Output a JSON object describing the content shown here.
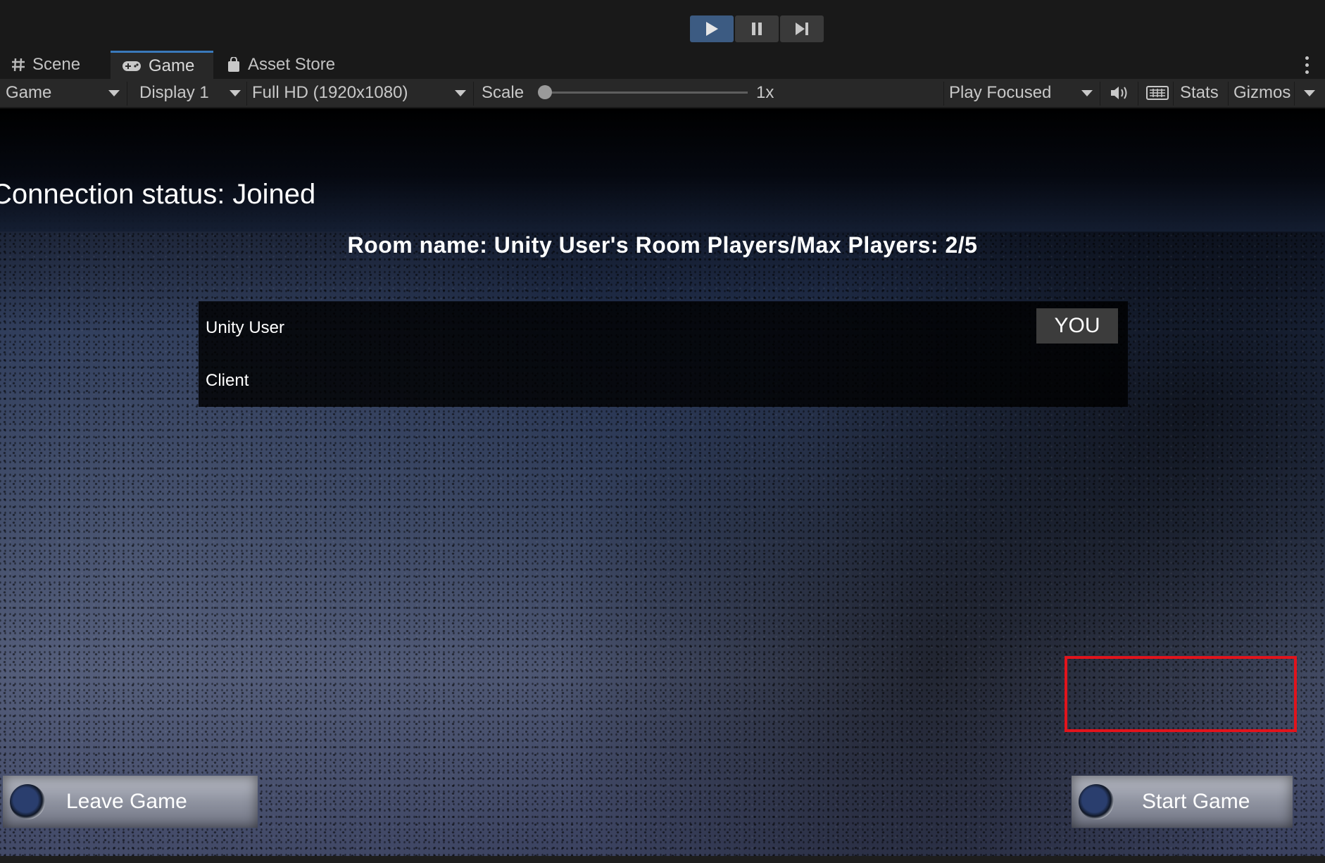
{
  "playbar": {
    "play_icon": "play-icon",
    "pause_icon": "pause-icon",
    "step_icon": "step-icon",
    "accent": "#3c5b82"
  },
  "tabs": [
    {
      "label": "Scene",
      "icon": "scene-grid-icon"
    },
    {
      "label": "Game",
      "icon": "gamepad-icon",
      "active": true
    },
    {
      "label": "Asset Store",
      "icon": "shopping-bag-icon"
    }
  ],
  "toolbar": {
    "view_select": "Game",
    "display_select": "Display 1",
    "resolution_select": "Full HD (1920x1080)",
    "scale_label": "Scale",
    "scale_value": "1x",
    "play_mode_select": "Play Focused",
    "stats_label": "Stats",
    "gizmos_label": "Gizmos"
  },
  "game": {
    "connection_status": "Connection status: Joined",
    "room_title": "Room name: Unity User's Room Players/Max Players: 2/5",
    "players": [
      {
        "name": "Unity User",
        "badge": "YOU"
      },
      {
        "name": "Client",
        "badge": ""
      }
    ],
    "leave_button": "Leave Game",
    "start_button": "Start Game",
    "highlight_color": "#e1141c"
  }
}
